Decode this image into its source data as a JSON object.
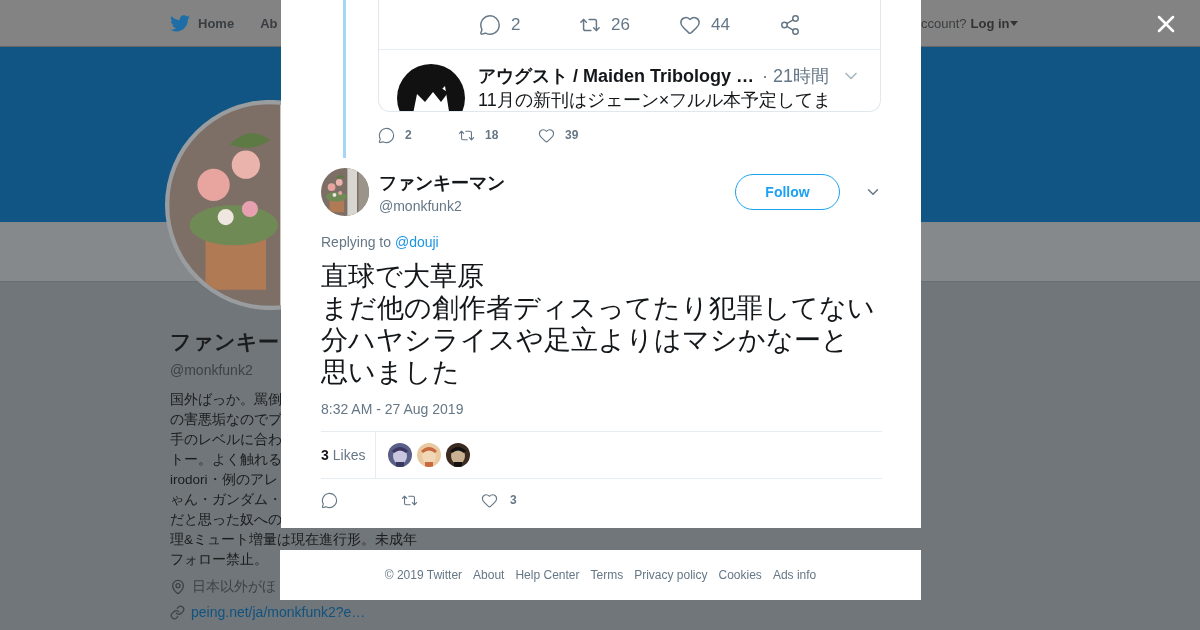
{
  "background": {
    "nav": {
      "items": [
        {
          "label": "Home",
          "kind": "home"
        },
        {
          "label": "Ab",
          "kind": "plain"
        }
      ],
      "account_prompt": "ccount?",
      "login": "Log in"
    },
    "profile": {
      "name": "ファンキー",
      "handle": "@monkfunk2",
      "bio_lines": [
        "国外ばっか。罵倒",
        "の害悪垢なのでブ",
        "手のレベルに合わ",
        "トー。よく触れる",
        "irodori・例のアレ",
        "ゃん・ガンダム・",
        "だと思った奴への",
        "理&ミュート増量は現在進行形。未成年",
        "フォロー禁止。"
      ],
      "location": "日本以外がほ",
      "link": "peing.net/ja/monkfunk2?e…"
    }
  },
  "modal": {
    "parent": {
      "card_actions": [
        {
          "kind": "reply",
          "count": "2"
        },
        {
          "kind": "retweet",
          "count": "26"
        },
        {
          "kind": "like",
          "count": "44"
        },
        {
          "kind": "share"
        }
      ],
      "embedded": {
        "author": "アウグスト / Maiden Tribology …",
        "time": "· 21時間",
        "text": "11月の新刊はジェーン×フルル本予定してま"
      },
      "actions": [
        {
          "kind": "reply",
          "count": "2"
        },
        {
          "kind": "retweet",
          "count": "18"
        },
        {
          "kind": "like",
          "count": "39"
        }
      ]
    },
    "tweet": {
      "name": "ファンキーマン",
      "handle": "@monkfunk2",
      "follow": "Follow",
      "replying_prefix": "Replying to",
      "reply_to": "@douji",
      "text_lines": [
        "直球で大草原",
        "まだ他の創作者ディスってたり犯罪してない",
        "分ハヤシライスや足立よりはマシかなーと",
        "思いました"
      ],
      "timestamp": "8:32 AM - 27 Aug 2019",
      "likes_count": "3",
      "likes_label": "Likes",
      "actions": [
        {
          "kind": "reply"
        },
        {
          "kind": "retweet"
        },
        {
          "kind": "like",
          "count": "3"
        }
      ]
    }
  },
  "footer": {
    "links": [
      "© 2019 Twitter",
      "About",
      "Help Center",
      "Terms",
      "Privacy policy",
      "Cookies",
      "Ads info"
    ]
  }
}
